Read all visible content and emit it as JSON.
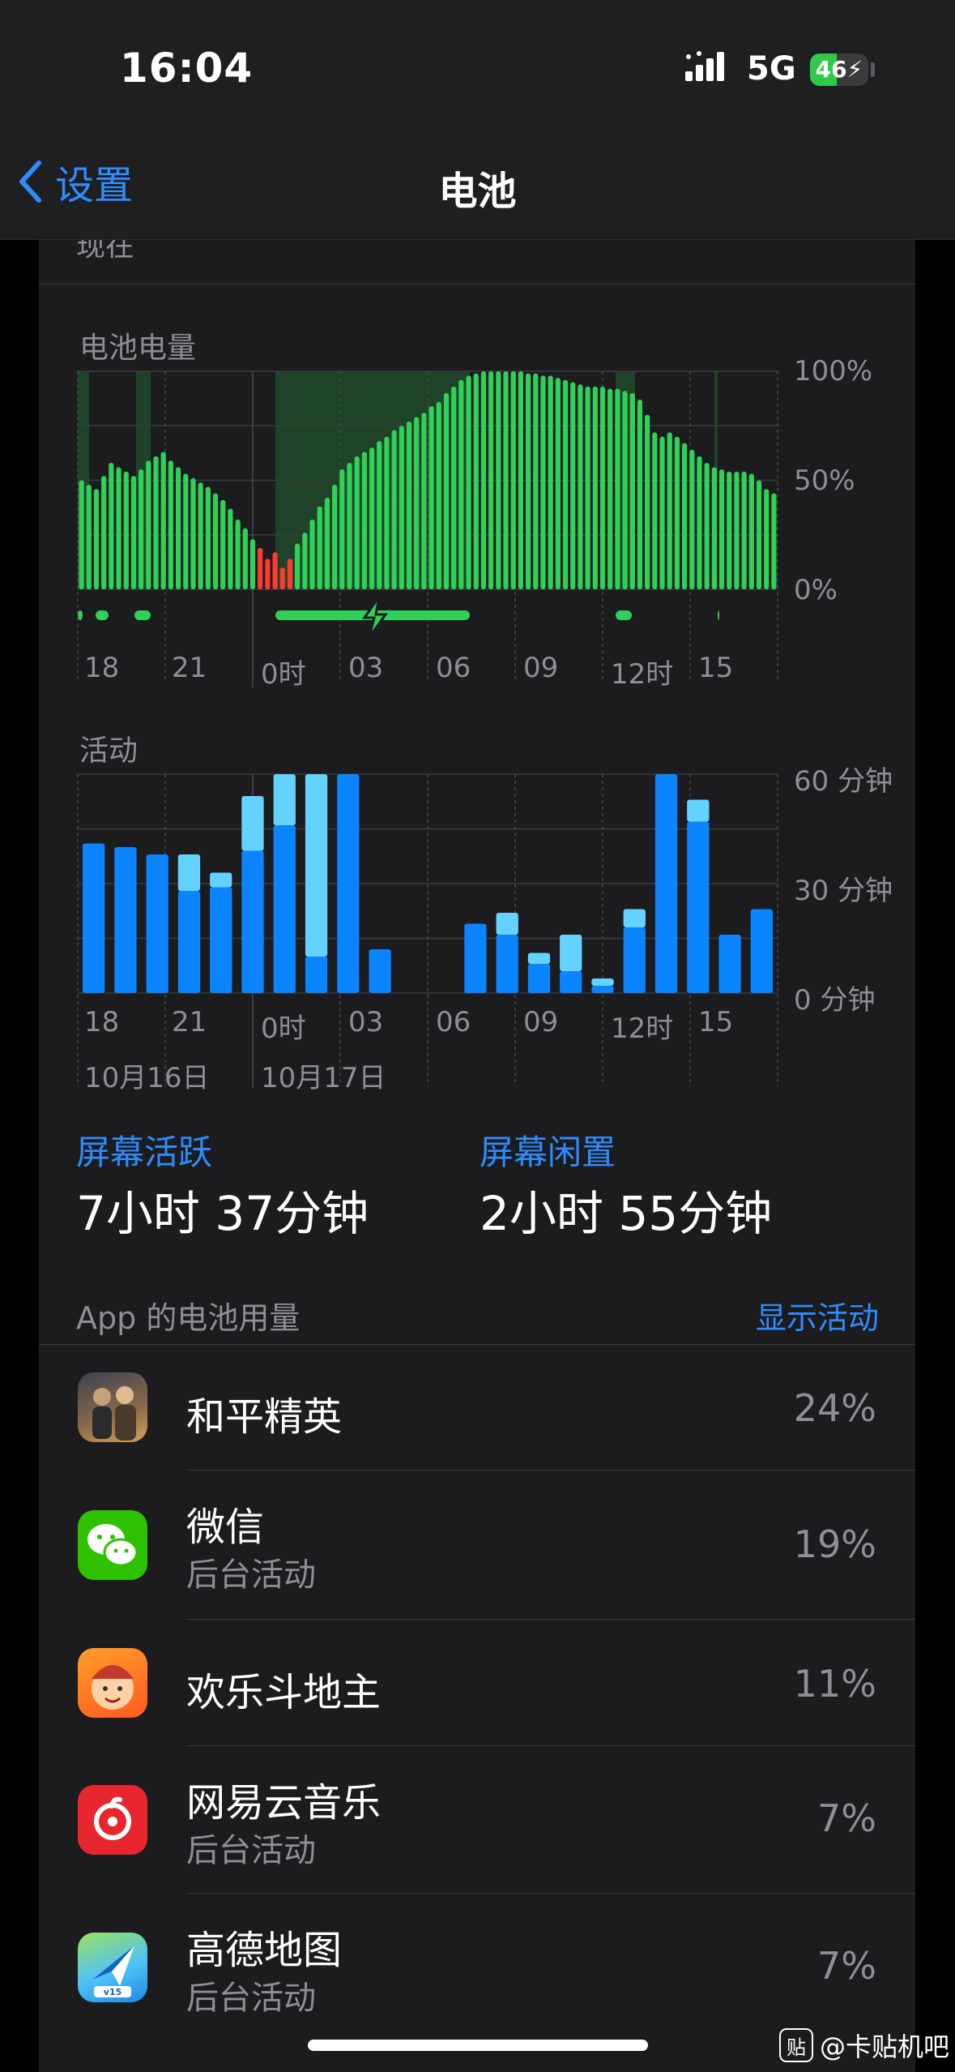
{
  "status_bar": {
    "time": "16:04",
    "network": "5G",
    "battery": "46",
    "battery_level": 0.46
  },
  "nav": {
    "back_label": "设置",
    "title": "电池"
  },
  "top_partial_label": "现在",
  "chart_data": [
    {
      "type": "bar",
      "title": "电池电量",
      "y_ticks": [
        "100%",
        "50%",
        "0%"
      ],
      "x_ticks": [
        "18",
        "21",
        "0时",
        "03",
        "06",
        "09",
        "12时",
        "15"
      ],
      "ylim": [
        0,
        100
      ],
      "grid": true,
      "charging_color": "#30d158",
      "low_color": "#ff3b30",
      "values": [
        50,
        48,
        46,
        52,
        58,
        56,
        54,
        52,
        55,
        59,
        61,
        63,
        59,
        56,
        53,
        51,
        49,
        47,
        44,
        41,
        37,
        32,
        28,
        23,
        19,
        14,
        17,
        10,
        14,
        21,
        26,
        32,
        38,
        42,
        48,
        55,
        58,
        61,
        63,
        65,
        68,
        70,
        73,
        75,
        77,
        79,
        81,
        84,
        86,
        90,
        93,
        96,
        98,
        99,
        100,
        100,
        100,
        100,
        100,
        100,
        99,
        99,
        98,
        98,
        97,
        96,
        95,
        94,
        93,
        93,
        93,
        92,
        92,
        91,
        90,
        87,
        80,
        72,
        70,
        72,
        70,
        67,
        64,
        61,
        58,
        56,
        55,
        54,
        54,
        54,
        53,
        50,
        46,
        44
      ]
    },
    {
      "type": "bar",
      "title": "活动",
      "y_ticks": [
        "60 分钟",
        "30 分钟",
        "0 分钟"
      ],
      "x_ticks": [
        "18",
        "21",
        "0时",
        "03",
        "06",
        "09",
        "12时",
        "15"
      ],
      "date_labels": [
        "10月16日",
        "10月17日"
      ],
      "ylim": [
        0,
        60
      ],
      "series": [
        {
          "name": "屏幕活跃",
          "color": "#0a84ff",
          "values": [
            41,
            40,
            38,
            28,
            29,
            39,
            46,
            10,
            60,
            12,
            0,
            0,
            19,
            16,
            8,
            6,
            2,
            18,
            60,
            47,
            16,
            23
          ]
        },
        {
          "name": "屏幕闲置",
          "color": "#64d2ff",
          "values": [
            0,
            0,
            0,
            10,
            4,
            15,
            14,
            50,
            0,
            0,
            0,
            0,
            0,
            6,
            3,
            10,
            2,
            5,
            0,
            6,
            0,
            0
          ]
        }
      ]
    }
  ],
  "summary": {
    "active_label": "屏幕活跃",
    "active_value": "7小时 37分钟",
    "idle_label": "屏幕闲置",
    "idle_value": "2小时 55分钟"
  },
  "apps_section": {
    "title": "App 的电池用量",
    "action": "显示活动"
  },
  "apps": [
    {
      "name": "和平精英",
      "sub": "",
      "pct": "24%",
      "icon": "pubg-mobile-icon"
    },
    {
      "name": "微信",
      "sub": "后台活动",
      "pct": "19%",
      "icon": "wechat-icon"
    },
    {
      "name": "欢乐斗地主",
      "sub": "",
      "pct": "11%",
      "icon": "doudizhu-icon"
    },
    {
      "name": "网易云音乐",
      "sub": "后台活动",
      "pct": "7%",
      "icon": "netease-music-icon"
    },
    {
      "name": "高德地图",
      "sub": "后台活动",
      "pct": "7%",
      "icon": "amap-icon"
    }
  ],
  "watermark": {
    "badge": "贴",
    "text": "@卡贴机吧"
  }
}
